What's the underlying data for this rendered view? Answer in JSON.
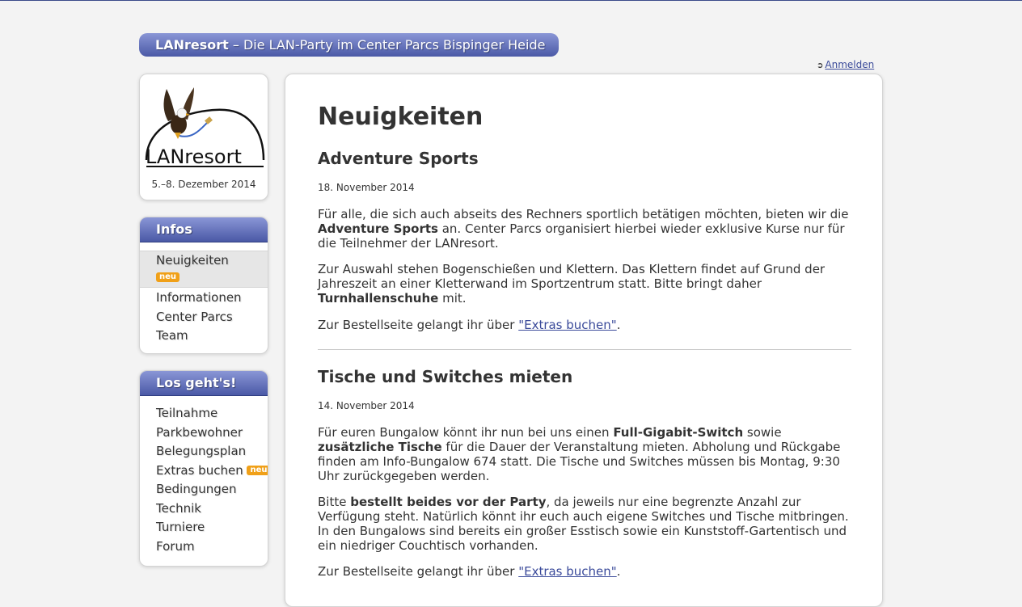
{
  "header": {
    "site_name": "LANresort",
    "tagline": "– Die LAN-Party im Center Parcs Bispinger Heide",
    "login_label": "Anmelden",
    "login_icon": "sign-in-icon"
  },
  "logo": {
    "text": "LANresort",
    "event_dates": "5.–8. Dezember 2014"
  },
  "infos_menu": {
    "title": "Infos",
    "items": [
      {
        "label": "Neuigkeiten",
        "badge": "neu",
        "active": true
      },
      {
        "label": "Informationen"
      },
      {
        "label": "Center Parcs"
      },
      {
        "label": "Team"
      }
    ]
  },
  "losgehts_menu": {
    "title": "Los geht's!",
    "items": [
      {
        "label": "Teilnahme"
      },
      {
        "label": "Parkbewohner"
      },
      {
        "label": "Belegungsplan"
      },
      {
        "label": "Extras buchen",
        "badge": "neu"
      },
      {
        "label": "Bedingungen"
      },
      {
        "label": "Technik"
      },
      {
        "label": "Turniere"
      },
      {
        "label": "Forum"
      }
    ]
  },
  "main": {
    "title": "Neuigkeiten",
    "posts": [
      {
        "title": "Adventure Sports",
        "date": "18. November 2014",
        "p1_a": "Für alle, die sich auch abseits des Rechners sportlich betätigen möchten, bieten wir die ",
        "p1_b": "Adventure Sports",
        "p1_c": " an. Center Parcs organisiert hierbei wieder exklusive Kurse nur für die Teilnehmer der LANresort.",
        "p2_a": "Zur Auswahl stehen Bogenschießen und Klettern. Das Klettern findet auf Grund der Jahreszeit an einer Kletterwand im Sportzentrum statt. Bitte bringt daher ",
        "p2_b": "Turnhallenschuhe",
        "p2_c": " mit.",
        "p3_a": "Zur Bestellseite gelangt ihr über ",
        "p3_link": "\"Extras buchen\"",
        "p3_c": "."
      },
      {
        "title": "Tische und Switches mieten",
        "date": "14. November 2014",
        "p1_a": "Für euren Bungalow könnt ihr nun bei uns einen ",
        "p1_b": "Full-Gigabit-Switch",
        "p1_c": " sowie ",
        "p1_d": "zusätzliche Tische",
        "p1_e": " für die Dauer der Veranstaltung mieten. Abholung und Rückgabe finden am Info-Bungalow 674 statt. Die Tische und Switches müssen bis Montag, 9:30 Uhr zurückgegeben werden.",
        "p2_a": "Bitte ",
        "p2_b": "bestellt beides vor der Party",
        "p2_c": ", da jeweils nur eine begrenzte Anzahl zur Verfügung steht. Natürlich könnt ihr euch auch eigene Switches und Tische mitbringen. In den Bungalows sind bereits ein großer Esstisch sowie ein Kunststoff-Gartentisch und ein niedriger Couchtisch vorhanden.",
        "p3_a": "Zur Bestellseite gelangt ihr über ",
        "p3_link": "\"Extras buchen\"",
        "p3_c": "."
      }
    ]
  },
  "colors": {
    "accent": "#4a59a6",
    "badge": "#f0a018",
    "link": "#3a4a9a",
    "page_bg": "#f3f3f3"
  }
}
